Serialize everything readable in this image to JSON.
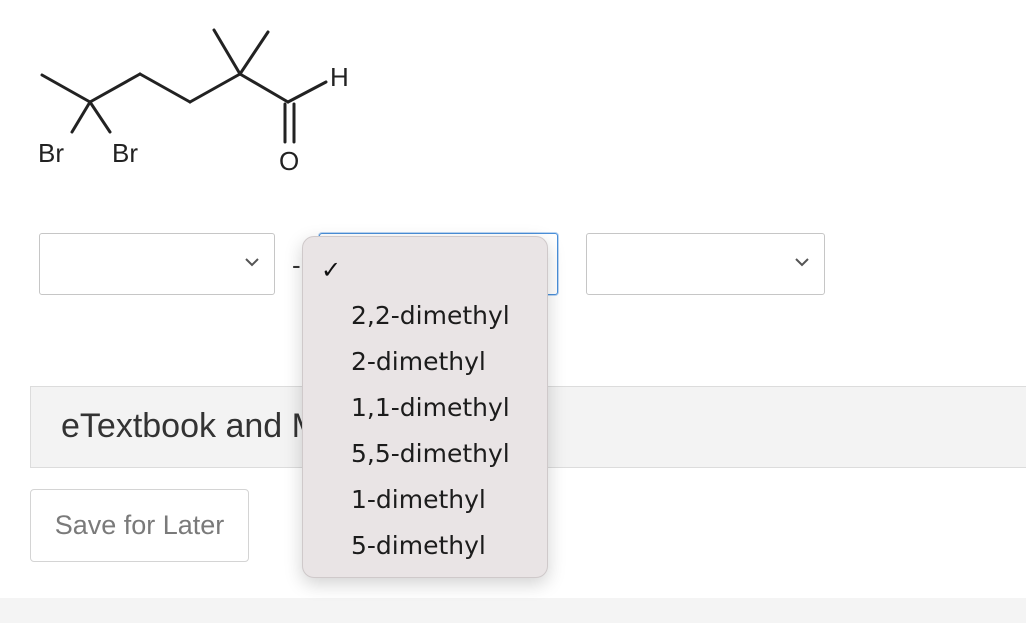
{
  "molecule": {
    "atom_labels": {
      "br1": "Br",
      "br2": "Br",
      "oxygen": "O",
      "hydrogen": "H"
    }
  },
  "name_builder": {
    "separator": "-",
    "select_1": {
      "value": ""
    },
    "select_2": {
      "value": "",
      "selected_mark": "✓",
      "options": [
        "",
        "2,2-dimethyl",
        "2-dimethyl",
        "1,1-dimethyl",
        "5,5-dimethyl",
        "1-dimethyl",
        "5-dimethyl"
      ]
    },
    "select_3": {
      "value": ""
    }
  },
  "etextbook": {
    "label": "eTextbook and Media"
  },
  "actions": {
    "save_label": "Save for Later"
  },
  "colors": {
    "focus_border": "#4a8fd9",
    "dropdown_bg": "#e9e4e5",
    "bar_bg": "#f3f3f3"
  }
}
